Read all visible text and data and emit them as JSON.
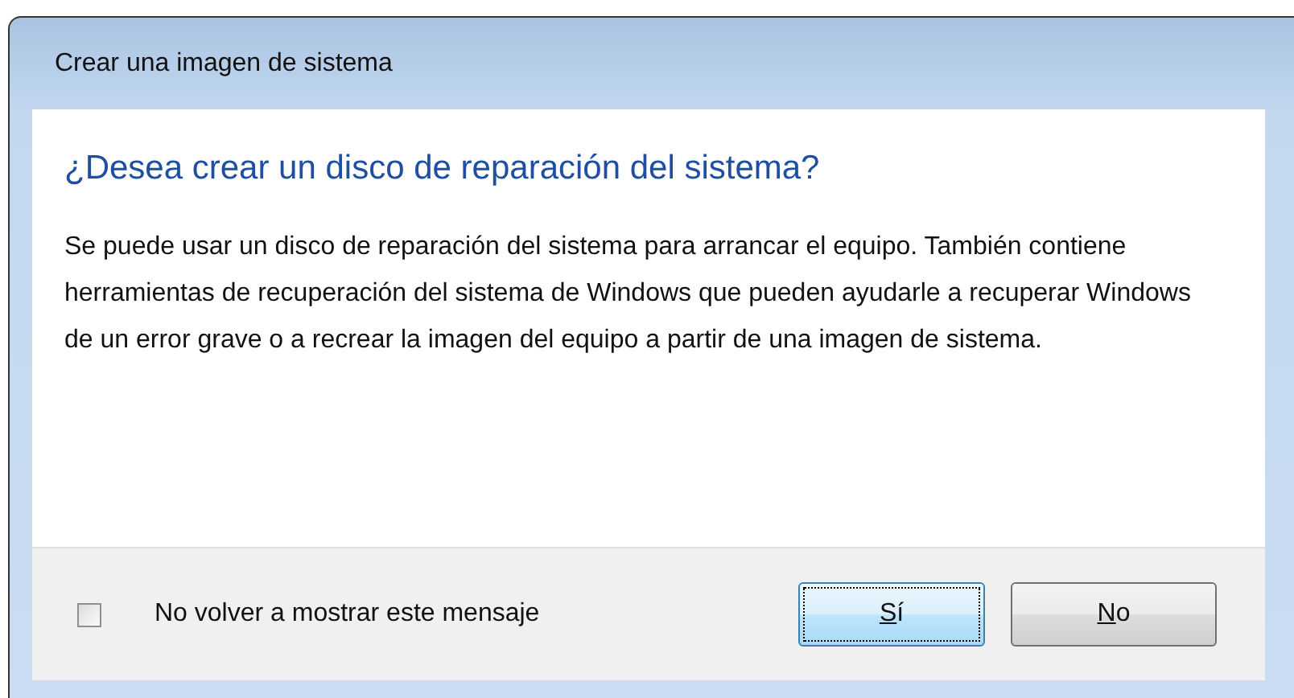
{
  "window": {
    "title": "Crear una imagen de sistema"
  },
  "heading": "¿Desea crear un disco de reparación del sistema?",
  "body": "Se puede usar un disco de reparación del sistema para arrancar el equipo. También contiene herramientas de recuperación del sistema de Windows que pueden ayudarle a recuperar Windows de un error grave o a recrear la imagen del equipo a partir de una imagen de sistema.",
  "checkbox": {
    "label": "No volver a mostrar este mensaje",
    "checked": false
  },
  "buttons": [
    {
      "access_key": "S",
      "rest": "í",
      "default": true
    },
    {
      "access_key": "N",
      "rest": "o",
      "default": false
    }
  ]
}
